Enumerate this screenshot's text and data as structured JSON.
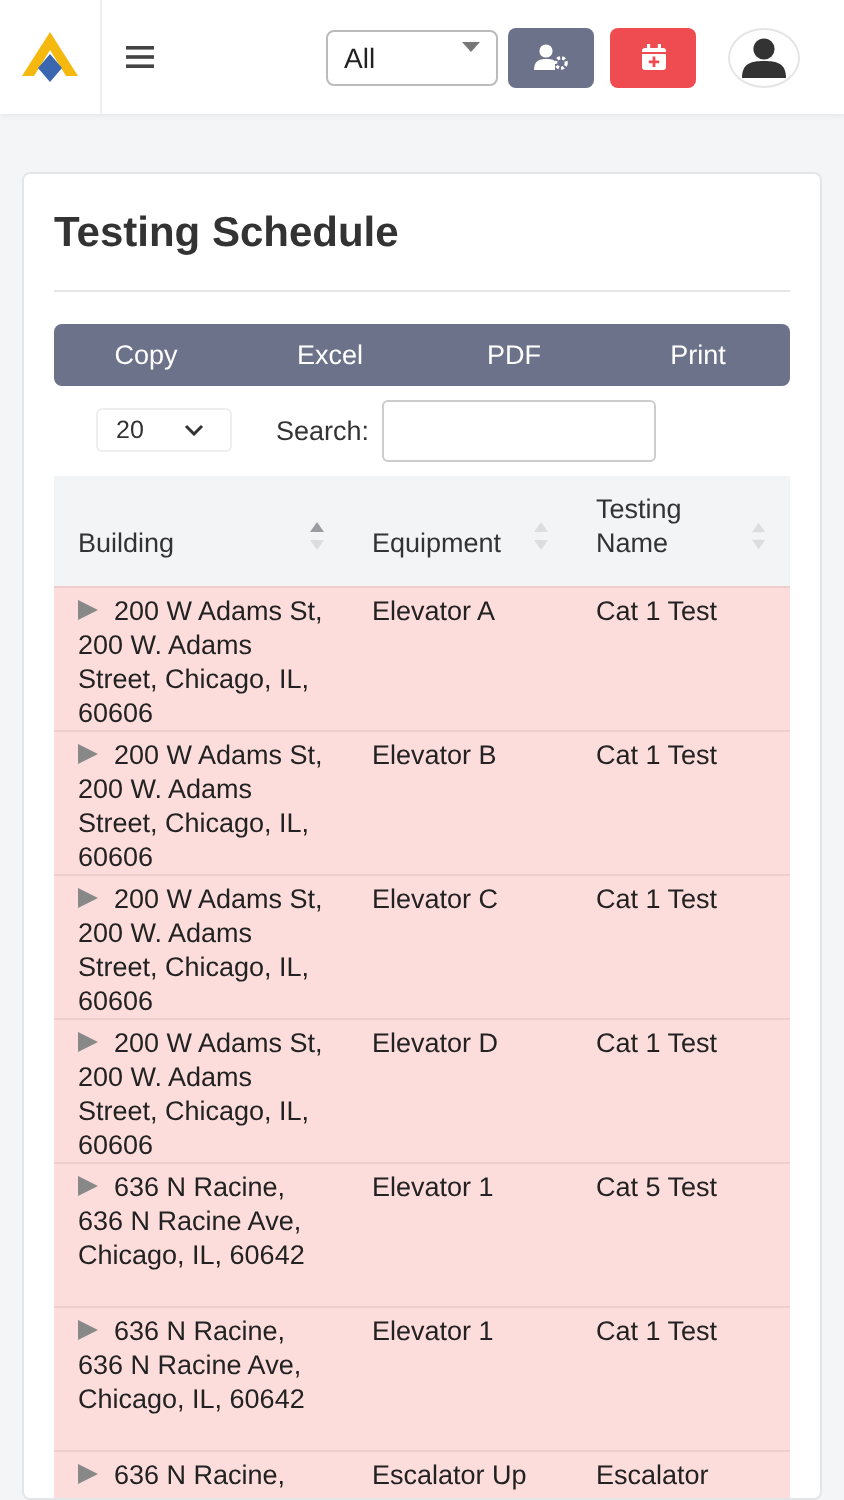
{
  "header": {
    "filter": {
      "value": "All"
    }
  },
  "card": {
    "title": "Testing Schedule",
    "export_buttons": [
      "Copy",
      "Excel",
      "PDF",
      "Print"
    ],
    "page_length": {
      "value": "20"
    },
    "search": {
      "label": "Search:"
    },
    "table": {
      "columns": [
        {
          "label": "Building",
          "sorted": true
        },
        {
          "label": "Equipment",
          "sorted": false
        },
        {
          "label": "Testing Name",
          "sorted": false
        }
      ],
      "rows": [
        {
          "building": "200 W Adams St, 200 W. Adams Street, Chicago, IL, 60606",
          "equipment": "Elevator A",
          "testing_name": "Cat 1 Test"
        },
        {
          "building": "200 W Adams St, 200 W. Adams Street, Chicago, IL, 60606",
          "equipment": "Elevator B",
          "testing_name": "Cat 1 Test"
        },
        {
          "building": "200 W Adams St, 200 W. Adams Street, Chicago, IL, 60606",
          "equipment": "Elevator C",
          "testing_name": "Cat 1 Test"
        },
        {
          "building": "200 W Adams St, 200 W. Adams Street, Chicago, IL, 60606",
          "equipment": "Elevator D",
          "testing_name": "Cat 1 Test"
        },
        {
          "building": "636 N Racine, 636 N Racine Ave, Chicago, IL, 60642",
          "equipment": "Elevator 1",
          "testing_name": "Cat 5 Test"
        },
        {
          "building": "636 N Racine, 636 N Racine Ave, Chicago, IL, 60642",
          "equipment": "Elevator 1",
          "testing_name": "Cat 1 Test"
        },
        {
          "building": "636 N Racine,",
          "equipment": "Escalator Up",
          "testing_name": "Escalator"
        }
      ]
    }
  }
}
